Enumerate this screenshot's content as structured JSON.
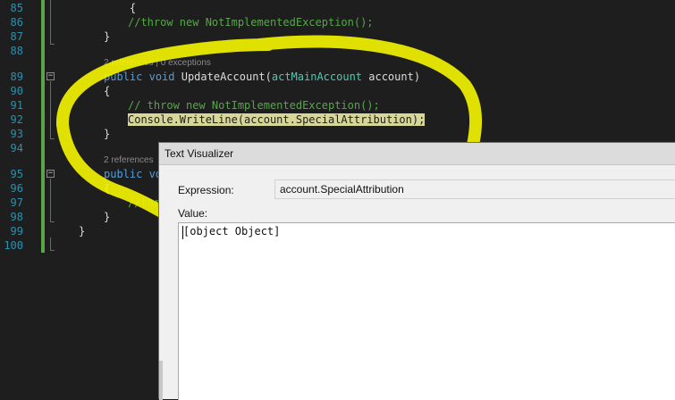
{
  "editor": {
    "lines": [
      {
        "n": "85",
        "segments": [
          {
            "t": "    {",
            "c": ""
          }
        ],
        "indent": 116
      },
      {
        "n": "86",
        "segments": [
          {
            "t": "//throw new NotImplementedException();",
            "c": "cm"
          }
        ],
        "indent": 143
      },
      {
        "n": "87",
        "segments": [
          {
            "t": "}",
            "c": ""
          }
        ],
        "indent": 116
      },
      {
        "n": "88",
        "segments": [],
        "indent": 116
      },
      {
        "n": "89",
        "segments": [
          {
            "t": "public",
            "c": "kw"
          },
          {
            "t": " ",
            "c": ""
          },
          {
            "t": "void",
            "c": "kw"
          },
          {
            "t": " UpdateAccount(",
            "c": ""
          },
          {
            "t": "actMainAccount",
            "c": "ty"
          },
          {
            "t": " account)",
            "c": ""
          }
        ],
        "indent": 116
      },
      {
        "n": "90",
        "segments": [
          {
            "t": "{",
            "c": ""
          }
        ],
        "indent": 116
      },
      {
        "n": "91",
        "segments": [
          {
            "t": "// throw new NotImplementedException();",
            "c": "cm"
          }
        ],
        "indent": 143
      },
      {
        "n": "92",
        "segments": [
          {
            "t": "Console.WriteLine(account.SpecialAttribution);",
            "c": "hl"
          }
        ],
        "indent": 143
      },
      {
        "n": "93",
        "segments": [
          {
            "t": "}",
            "c": ""
          }
        ],
        "indent": 116
      },
      {
        "n": "94",
        "segments": [],
        "indent": 116
      },
      {
        "n": "95",
        "segments": [
          {
            "t": "public",
            "c": "kw"
          },
          {
            "t": " vo",
            "c": "kw"
          }
        ],
        "indent": 116
      },
      {
        "n": "96",
        "segments": [
          {
            "t": "{",
            "c": ""
          }
        ],
        "indent": 116
      },
      {
        "n": "97",
        "segments": [
          {
            "t": "//thr",
            "c": "cm"
          }
        ],
        "indent": 143
      },
      {
        "n": "98",
        "segments": [
          {
            "t": "}",
            "c": ""
          }
        ],
        "indent": 116
      },
      {
        "n": "99",
        "segments": [
          {
            "t": "}",
            "c": ""
          }
        ],
        "indent": 88
      },
      {
        "n": "100",
        "segments": [],
        "indent": 88
      }
    ],
    "codelens_1": "2 references | 0 exceptions",
    "codelens_2": "2 references"
  },
  "dialog": {
    "title": "Text Visualizer",
    "expression_label": "Expression:",
    "expression_value": "account.SpecialAttribution",
    "value_label": "Value:",
    "value_text": "[object Object]"
  },
  "annotation": {
    "color": "#f5f500"
  },
  "colors": {
    "keyword": "#569cd6",
    "type": "#4ec9b0",
    "comment": "#57a64a",
    "line_number": "#2b91af",
    "highlight": "#d7d79a"
  }
}
